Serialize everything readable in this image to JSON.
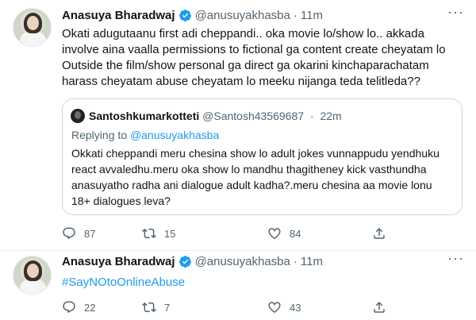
{
  "tweets": [
    {
      "author_name": "Anasuya Bharadwaj",
      "handle": "@anusuyakhasba",
      "separator": "·",
      "time": "11m",
      "text": "Okati adugutaanu first adi cheppandi.. oka movie lo/show lo.. akkada involve aina vaalla permissions to fictional ga content create cheyatam lo Outside the film/show personal ga direct ga okarini kinchaparachatam harass cheyatam abuse cheyatam lo meeku nijanga teda telitleda??",
      "quote": {
        "author_name": "Santoshkumarkotteti",
        "handle": "@Santosh43569687",
        "separator": "·",
        "time": "22m",
        "replying_prefix": "Replying to",
        "replying_to": "@anusuyakhasba",
        "text": "Okkati cheppandi meru chesina show lo adult jokes vunnappudu yendhuku react avvaledhu.meru oka show lo mandhu thagitheney kick vasthundha anasuyatho radha ani dialogue adult kadha?.meru chesina aa movie lonu 18+ dialogues leva?"
      },
      "actions": {
        "replies": "87",
        "retweets": "15",
        "likes": "84"
      }
    },
    {
      "author_name": "Anasuya Bharadwaj",
      "handle": "@anusuyakhasba",
      "separator": "·",
      "time": "11m",
      "hashtag": "#SayNOtoOnlineAbuse",
      "actions": {
        "replies": "22",
        "retweets": "7",
        "likes": "43"
      }
    }
  ],
  "icons": {
    "verified": "verified-badge-icon",
    "more": "more-options-icon",
    "reply": "reply-icon",
    "retweet": "retweet-icon",
    "like": "heart-icon",
    "share": "share-icon"
  },
  "colors": {
    "accent": "#1d9bf0",
    "text": "#0f1419",
    "secondary": "#536471",
    "border": "#cfd9de"
  }
}
